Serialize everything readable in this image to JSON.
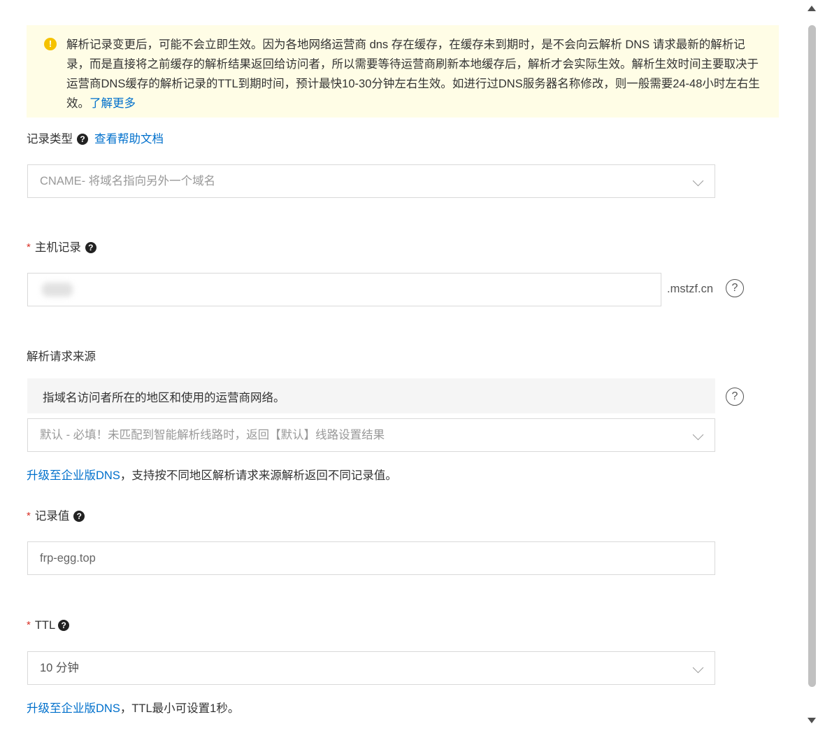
{
  "notice": {
    "text": "解析记录变更后，可能不会立即生效。因为各地网络运营商 dns 存在缓存，在缓存未到期时，是不会向云解析 DNS 请求最新的解析记录，而是直接将之前缓存的解析结果返回给访问者，所以需要等待运营商刷新本地缓存后，解析才会实际生效。解析生效时间主要取决于运营商DNS缓存的解析记录的TTL到期时间，预计最快10-30分钟左右生效。如进行过DNS服务器名称修改，则一般需要24-48小时左右生效。",
    "link": "了解更多",
    "icon": "warning-icon"
  },
  "record_type": {
    "label": "记录类型",
    "help_link": "查看帮助文档",
    "value": "CNAME- 将域名指向另外一个域名"
  },
  "host_record": {
    "label": "主机记录",
    "value": "",
    "suffix": ".mstzf.cn"
  },
  "request_source": {
    "label": "解析请求来源",
    "description": "指域名访问者所在的地区和使用的运营商网络。",
    "value": "默认 - 必填！未匹配到智能解析线路时，返回【默认】线路设置结果",
    "upgrade_link": "升级至企业版DNS",
    "upgrade_text": "，支持按不同地区解析请求来源解析返回不同记录值。"
  },
  "record_value": {
    "label": "记录值",
    "value": "frp-egg.top"
  },
  "ttl": {
    "label": "TTL",
    "value": "10 分钟",
    "upgrade_link": "升级至企业版DNS",
    "upgrade_text": "，TTL最小可设置1秒。"
  },
  "required_mark": "*",
  "help_glyph": "?",
  "colors": {
    "link": "#0070cc",
    "notice_bg": "#fffde6",
    "warning": "#f5c200",
    "required": "#d93026"
  }
}
